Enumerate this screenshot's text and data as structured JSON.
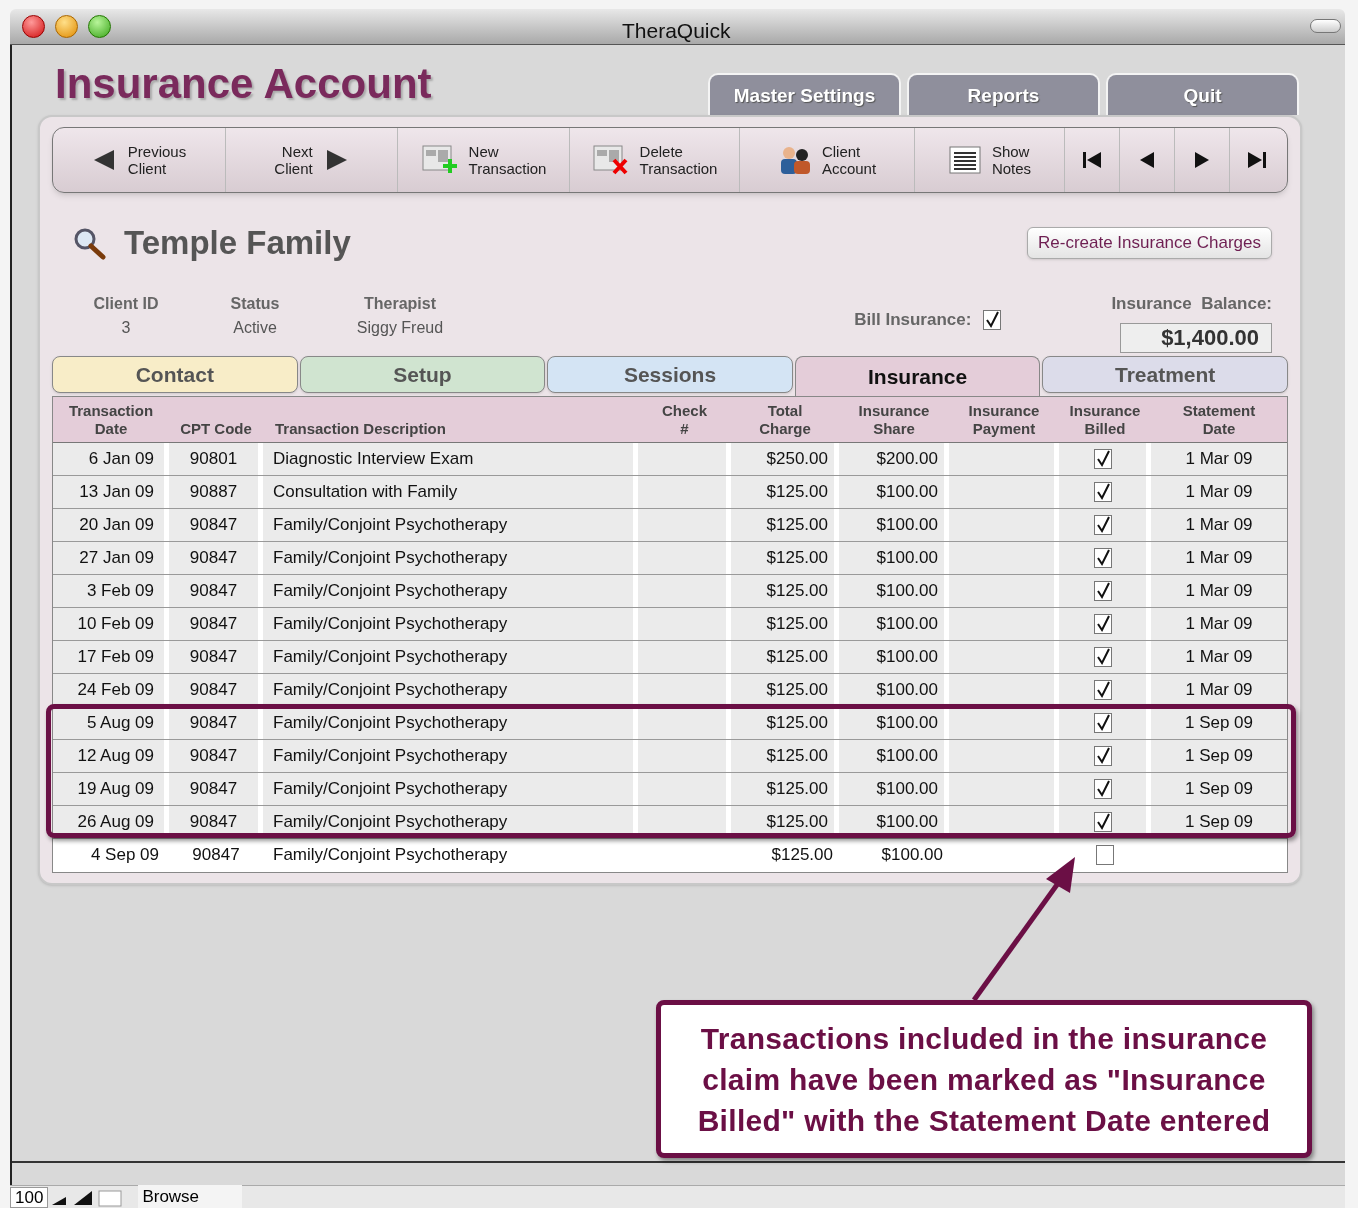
{
  "window": {
    "title": "TheraQuick"
  },
  "header": {
    "title": "Insurance Account"
  },
  "top_tabs": [
    "Master Settings",
    "Reports",
    "Quit"
  ],
  "toolbar": [
    {
      "kind": "previous",
      "label": "Previous\nClient"
    },
    {
      "kind": "next",
      "label": "Next\nClient"
    },
    {
      "kind": "new",
      "label": "New\nTransaction"
    },
    {
      "kind": "delete",
      "label": "Delete\nTransaction"
    },
    {
      "kind": "people",
      "label": "Client\nAccount"
    },
    {
      "kind": "notes",
      "label": "Show\nNotes"
    },
    {
      "kind": "first"
    },
    {
      "kind": "back"
    },
    {
      "kind": "forward"
    },
    {
      "kind": "last"
    }
  ],
  "client": {
    "name": "Temple Family",
    "recreate_button": "Re-create Insurance Charges",
    "fields": [
      {
        "label": "Client ID",
        "value": "3"
      },
      {
        "label": "Status",
        "value": "Active"
      },
      {
        "label": "Therapist",
        "value": "Siggy Freud"
      }
    ],
    "bill_insurance": {
      "label": "Bill Insurance:",
      "checked": true
    },
    "balance": {
      "label": "Insurance  Balance:",
      "value": "$1,400.00"
    }
  },
  "tabs": [
    {
      "label": "Contact",
      "selected": false,
      "color": "#f8edc8"
    },
    {
      "label": "Setup",
      "selected": false,
      "color": "#d0e4d0"
    },
    {
      "label": "Sessions",
      "selected": false,
      "color": "#d4e4f4"
    },
    {
      "label": "Insurance",
      "selected": true,
      "color": "#e4cdd9"
    },
    {
      "label": "Treatment",
      "selected": false,
      "color": "#dcdcea"
    }
  ],
  "table": {
    "columns": [
      "Transaction\nDate",
      "CPT Code",
      "Transaction Description",
      "Check\n#",
      "Total\nCharge",
      "Insurance\nShare",
      "Insurance\nPayment",
      "Insurance\nBilled",
      "Statement\nDate"
    ],
    "rows": [
      {
        "date": "6 Jan 09",
        "cpt": "90801",
        "description": "Diagnostic Interview Exam",
        "total": "$250.00",
        "share": "$200.00",
        "billed": true,
        "statement_date": "1 Mar 09"
      },
      {
        "date": "13 Jan 09",
        "cpt": "90887",
        "description": "Consultation with Family",
        "total": "$125.00",
        "share": "$100.00",
        "billed": true,
        "statement_date": "1 Mar 09"
      },
      {
        "date": "20 Jan 09",
        "cpt": "90847",
        "description": "Family/Conjoint Psychotherapy",
        "total": "$125.00",
        "share": "$100.00",
        "billed": true,
        "statement_date": "1 Mar 09"
      },
      {
        "date": "27 Jan 09",
        "cpt": "90847",
        "description": "Family/Conjoint Psychotherapy",
        "total": "$125.00",
        "share": "$100.00",
        "billed": true,
        "statement_date": "1 Mar 09"
      },
      {
        "date": "3 Feb 09",
        "cpt": "90847",
        "description": "Family/Conjoint Psychotherapy",
        "total": "$125.00",
        "share": "$100.00",
        "billed": true,
        "statement_date": "1 Mar 09"
      },
      {
        "date": "10 Feb 09",
        "cpt": "90847",
        "description": "Family/Conjoint Psychotherapy",
        "total": "$125.00",
        "share": "$100.00",
        "billed": true,
        "statement_date": "1 Mar 09"
      },
      {
        "date": "17 Feb 09",
        "cpt": "90847",
        "description": "Family/Conjoint Psychotherapy",
        "total": "$125.00",
        "share": "$100.00",
        "billed": true,
        "statement_date": "1 Mar 09"
      },
      {
        "date": "24 Feb 09",
        "cpt": "90847",
        "description": "Family/Conjoint Psychotherapy",
        "total": "$125.00",
        "share": "$100.00",
        "billed": true,
        "statement_date": "1 Mar 09"
      },
      {
        "date": "5 Aug 09",
        "cpt": "90847",
        "description": "Family/Conjoint Psychotherapy",
        "total": "$125.00",
        "share": "$100.00",
        "billed": true,
        "statement_date": "1 Sep 09"
      },
      {
        "date": "12 Aug 09",
        "cpt": "90847",
        "description": "Family/Conjoint Psychotherapy",
        "total": "$125.00",
        "share": "$100.00",
        "billed": true,
        "statement_date": "1 Sep 09"
      },
      {
        "date": "19 Aug 09",
        "cpt": "90847",
        "description": "Family/Conjoint Psychotherapy",
        "total": "$125.00",
        "share": "$100.00",
        "billed": true,
        "statement_date": "1 Sep 09"
      },
      {
        "date": "26 Aug 09",
        "cpt": "90847",
        "description": "Family/Conjoint Psychotherapy",
        "total": "$125.00",
        "share": "$100.00",
        "billed": true,
        "statement_date": "1 Sep 09"
      },
      {
        "date": "4 Sep 09",
        "cpt": "90847",
        "description": "Family/Conjoint Psychotherapy",
        "total": "$125.00",
        "share": "$100.00",
        "billed": false
      }
    ]
  },
  "callout": {
    "text": "Transactions included in the insurance claim have been marked as \"Insurance Billed\" with the Statement Date entered"
  },
  "status_bar": {
    "zoom": "100",
    "mode": "Browse"
  }
}
